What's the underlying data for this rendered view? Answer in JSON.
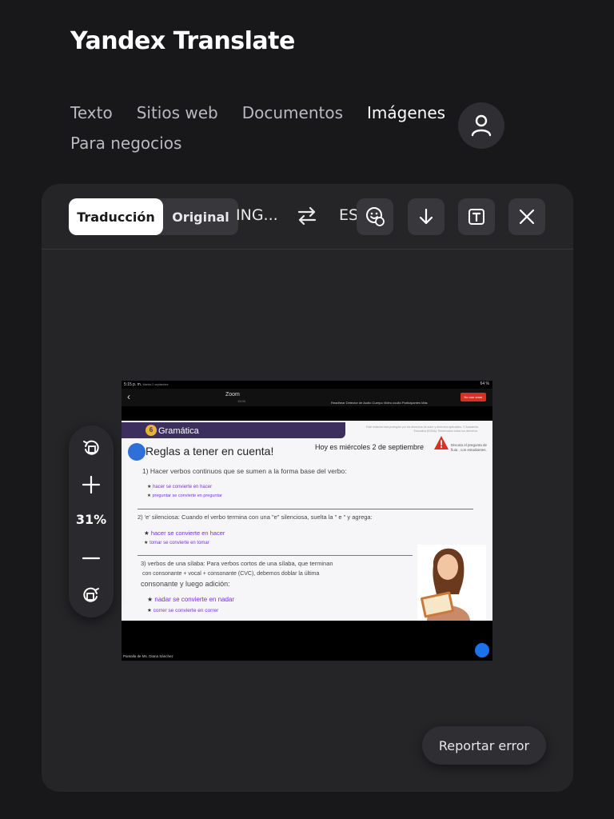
{
  "app": {
    "brand": "Yandex Translate"
  },
  "nav": {
    "items": [
      {
        "label": "Texto",
        "active": false
      },
      {
        "label": "Sitios web",
        "active": false
      },
      {
        "label": "Documentos",
        "active": false
      },
      {
        "label": "Imágenes",
        "active": true
      }
    ],
    "business": "Para negocios"
  },
  "toolbar": {
    "translation_label": "Traducción",
    "original_label": "Original",
    "source_lang": "ING...",
    "target_lang": "ES...",
    "icons": [
      "feedback-smile-icon",
      "download-icon",
      "text-mode-icon",
      "close-icon"
    ]
  },
  "zoom": {
    "value": "31%"
  },
  "report": {
    "label": "Reportar error"
  },
  "colors": {
    "background": "#18181b",
    "panel": "#252528",
    "button": "#38383c",
    "accent_white": "#ffffff"
  },
  "screenshot": {
    "status_time": "5:15 p. m.",
    "status_day": "Martes 2 septiembre",
    "status_battery": "64 %",
    "app_name": "Zoom",
    "app_sub": "15:00",
    "toolbar_items": "Readhear Detector de Audio Cuerpo  Video ocultó  Participantes  Más",
    "end_button": "No con omer",
    "header_title": "Gramática",
    "header_badge": "6",
    "copyright": "Este material está protegido por los derechos de autor y derechos aplicables. © Academia Educativa (EDNA). Reservados todos los derechos.",
    "slide_title": "Reglas a tener en cuenta!",
    "slide_date": "Hoy es miércoles 2 de septiembre",
    "slide_note": "Discuta el pregunta de fiuia , con estudiantes.",
    "rule1": "1) Hacer verbos continuos que se sumen a la forma base del verbo:",
    "rule1_a": "hacer se convierte en hacer",
    "rule1_b": "preguntar se convierte en preguntar",
    "rule2": "2) 'e' silenciosa: Cuando el verbo termina con una \"e\" silenciosa, suelta la \" e \" y agrega:",
    "rule2_a": "hacer se convierte en hacer",
    "rule2_b": "tomar se convierte en tomar",
    "rule3_line1": "3) verbos de una sílaba: Para verbos cortos de una sílaba, que terminan",
    "rule3_line2": "con consonante + vocal + consonante (CVC), debemos doblar la última",
    "rule3_line3": "consonante y luego adición:",
    "rule3_a": "nadar se convierte en nadar",
    "rule3_b": "correr se convierte en correr",
    "footer": "Pantalla de Ms. Diana Sánchez"
  }
}
